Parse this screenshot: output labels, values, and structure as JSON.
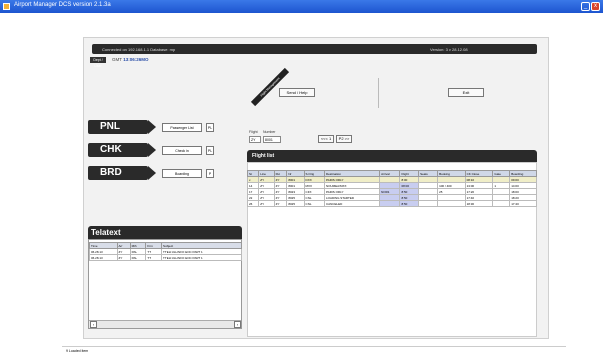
{
  "window": {
    "title": "Airport Manager DCS  version 2.1.3a",
    "minimize": "_",
    "close": "x"
  },
  "header": {
    "connection": "Connected on  192.168.1.1  Database:  mp",
    "version": "Version:  3 v 28.12.08",
    "tag": "Dept / User",
    "gmt_label": "GMT",
    "gmt_value": "13:06:26MO"
  },
  "ribbons": {
    "corner": "",
    "flight_selection": "Flight Management"
  },
  "actions": {
    "send": "Send / Help",
    "exit": "Exit"
  },
  "modules": [
    {
      "label": "PNL",
      "action": "Passenger List",
      "flag": "PL"
    },
    {
      "label": "CHK",
      "action": "Check in",
      "flag": "PL"
    },
    {
      "label": "BRD",
      "action": "Boarding",
      "flag": "P"
    }
  ],
  "flight_search": {
    "flight_label": "Flight",
    "flight_value": "ZY",
    "number_label": "Number",
    "number_value": "8001",
    "prev": "<<< 1",
    "next": "P2 >>"
  },
  "flight_list": {
    "title": "Flight list",
    "columns": [
      "St",
      "Line",
      "Fkt",
      "Nr",
      "S.Orig",
      "Destination",
      "Arrival",
      "Flight",
      "Seats",
      "Booking",
      "CK Close",
      "Gate",
      "Boarding"
    ],
    "rows": [
      [
        "x",
        "ZY",
        "ZY",
        "8001",
        "DXX",
        "PARIS ORLY",
        "",
        "8:00",
        "",
        "",
        "08:10",
        "",
        "09:00"
      ],
      [
        "14",
        "ZY",
        "ZY",
        "8001",
        "MXX",
        "NOUMEA/MXX",
        "",
        "08:00",
        "",
        "100 / 400",
        "13:00",
        "1",
        "14:00"
      ],
      [
        "17",
        "ZY",
        "ZY",
        "8023",
        "CFX",
        "PARIS ORLY",
        "NOR1",
        "8:50",
        "",
        "25",
        "17:20",
        "",
        "18:00"
      ],
      [
        "22",
        "ZY",
        "ZY",
        "8025",
        "CNL",
        "LOADING STARTED",
        "",
        "8:50",
        "",
        "",
        "17:40",
        "",
        "18:20"
      ],
      [
        "26",
        "ZY",
        "ZY",
        "8025",
        "CNL",
        "CANCELED",
        "",
        "8:50",
        "",
        "",
        "18:30",
        "",
        "17:40"
      ]
    ]
  },
  "telatext": {
    "title": "Telatext",
    "columns": [
      "Time",
      "Arr",
      "Mth",
      "Frm",
      "Subject"
    ],
    "rows": [
      [
        "06.28.13",
        "ZY",
        "PAL",
        "TT",
        "TTEH:ULLINFO EOC PART 1"
      ],
      [
        "06.28.13",
        "ZY",
        "PAL",
        "TT",
        "TTEH:ULLINFO EOC PART 1"
      ]
    ]
  },
  "status": {
    "text": "9 Loaded item"
  }
}
